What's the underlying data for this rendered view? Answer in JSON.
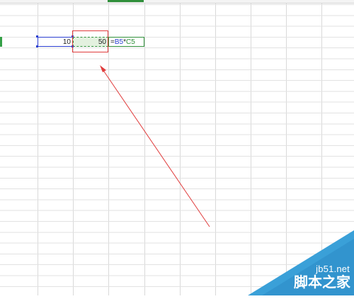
{
  "sheet": {
    "cells": {
      "b5": "10",
      "c5": "50",
      "d5_prefix": "=",
      "d5_ref1": "B5",
      "d5_op": "*",
      "d5_ref2": "C5"
    }
  },
  "annotation": {
    "highlight_color": "#e03b3b",
    "arrow_color": "#e03b3b"
  },
  "watermark": {
    "site": "jb51.net",
    "name": "脚本之家",
    "color": "#3aa0d8"
  }
}
